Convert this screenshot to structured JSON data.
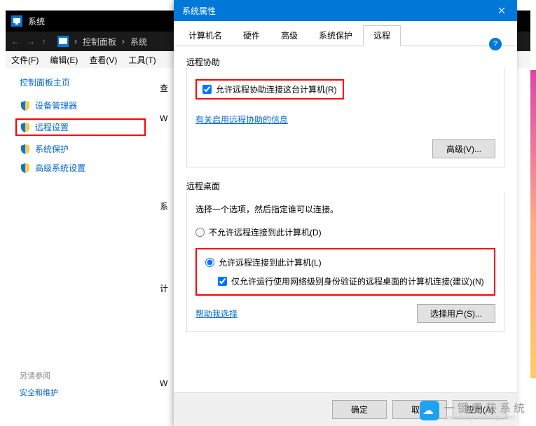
{
  "bg": {
    "title": "系统",
    "nav": {
      "path1": "控制面板",
      "path2": "系统"
    },
    "menu": [
      "文件(F)",
      "编辑(E)",
      "查看(V)",
      "工具(T)"
    ],
    "sidebar": {
      "title": "控制面板主页",
      "items": [
        {
          "label": "设备管理器"
        },
        {
          "label": "远程设置"
        },
        {
          "label": "系统保护"
        },
        {
          "label": "高级系统设置"
        }
      ]
    },
    "related": {
      "title": "另请参阅",
      "link": "安全和维护"
    },
    "main": {
      "l1": "查",
      "l2": "W",
      "l3": "系",
      "l4": "计",
      "l5": "W"
    }
  },
  "dialog": {
    "title": "系统属性",
    "tabs": [
      "计算机名",
      "硬件",
      "高级",
      "系统保护",
      "远程"
    ],
    "remote_assist": {
      "label": "远程协助",
      "allow": "允许远程协助连接这台计算机(R)",
      "info_link": "有关启用远程协助的信息",
      "advanced_btn": "高级(V)..."
    },
    "remote_desktop": {
      "label": "远程桌面",
      "desc": "选择一个选项，然后指定谁可以连接。",
      "disallow": "不允许远程连接到此计算机(D)",
      "allow": "允许远程连接到此计算机(L)",
      "nla": "仅允许运行使用网络级别身份验证的远程桌面的计算机连接(建议)(N)",
      "help_link": "帮助我选择",
      "select_users_btn": "选择用户(S)..."
    },
    "footer": {
      "ok": "确定",
      "cancel": "取消",
      "apply": "应用(A)"
    }
  },
  "watermark": {
    "text": "一键重装系统",
    "url": "www.baiyunxitong.com"
  }
}
